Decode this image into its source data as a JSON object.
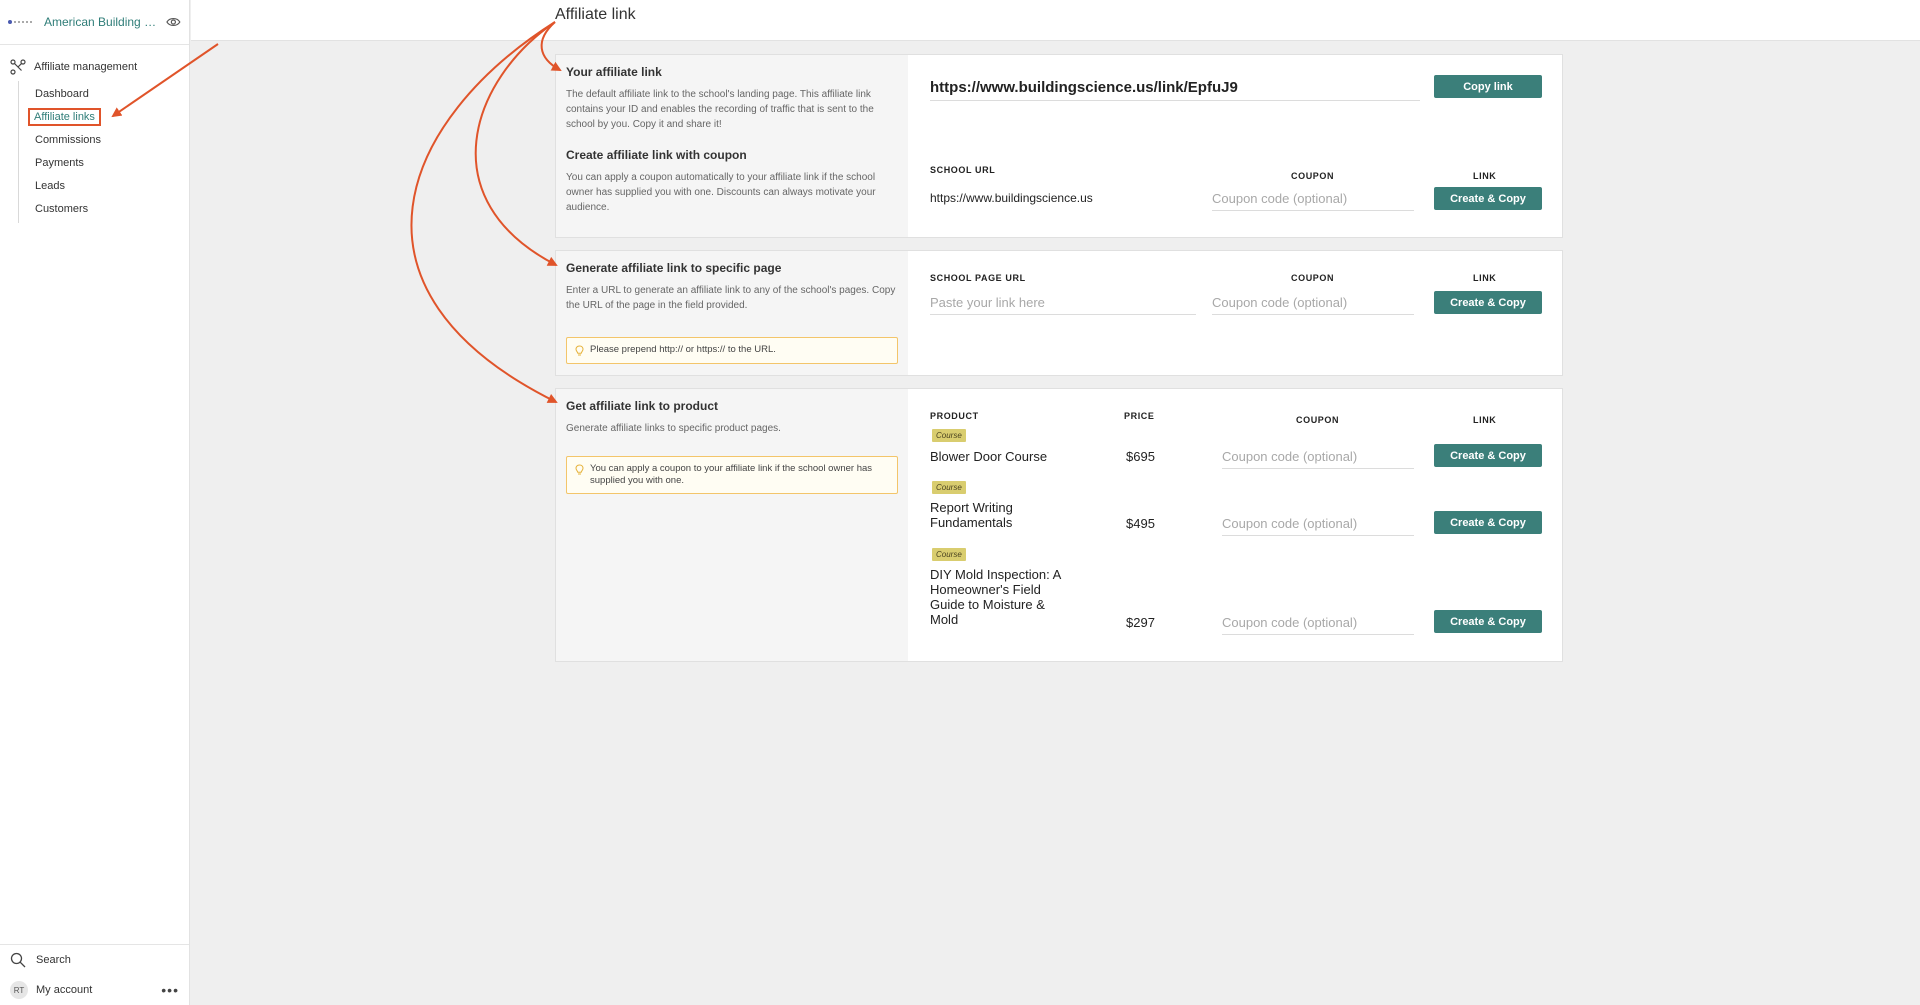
{
  "sidebar": {
    "school_name": "American Building Sc...",
    "section_title": "Affiliate management",
    "items": [
      {
        "label": "Dashboard"
      },
      {
        "label": "Affiliate links"
      },
      {
        "label": "Commissions"
      },
      {
        "label": "Payments"
      },
      {
        "label": "Leads"
      },
      {
        "label": "Customers"
      }
    ],
    "search_label": "Search",
    "account_label": "My account",
    "avatar_initials": "RT"
  },
  "page_title": "Affiliate link",
  "section1": {
    "title": "Your affiliate link",
    "desc": "The default affiliate link to the school's landing page. This affiliate link contains your ID and enables the recording of traffic that is sent to the school by you. Copy it and share it!",
    "link": "https://www.buildingscience.us/link/EpfuJ9",
    "copy_button": "Copy link",
    "coupon_title": "Create affiliate link with coupon",
    "coupon_desc": "You can apply a coupon automatically to your affiliate link if the school owner has supplied you with one. Discounts can always motivate your audience.",
    "col_school_url": "SCHOOL URL",
    "col_coupon": "COUPON",
    "col_link": "LINK",
    "school_url": "https://www.buildingscience.us",
    "coupon_placeholder": "Coupon code (optional)",
    "create_button": "Create & Copy"
  },
  "section2": {
    "title": "Generate affiliate link to specific page",
    "desc": "Enter a URL to generate an affiliate link to any of the school's pages. Copy the URL of the page in the field provided.",
    "tip": "Please prepend http:// or https:// to the URL.",
    "col_page_url": "SCHOOL PAGE URL",
    "col_coupon": "COUPON",
    "col_link": "LINK",
    "page_placeholder": "Paste your link here",
    "coupon_placeholder": "Coupon code (optional)",
    "create_button": "Create & Copy"
  },
  "section3": {
    "title": "Get affiliate link to product",
    "desc": "Generate affiliate links to specific product pages.",
    "tip": "You can apply a coupon to your affiliate link if the school owner has supplied you with one.",
    "col_product": "PRODUCT",
    "col_price": "PRICE",
    "col_coupon": "COUPON",
    "col_link": "LINK",
    "products": [
      {
        "badge": "Course",
        "name": "Blower Door Course",
        "price": "$695"
      },
      {
        "badge": "Course",
        "name": "Report Writing Fundamentals",
        "price": "$495"
      },
      {
        "badge": "Course",
        "name": "DIY Mold Inspection: A Homeowner's Field Guide to Moisture & Mold",
        "price": "$297"
      }
    ],
    "coupon_placeholder": "Coupon code (optional)",
    "create_button": "Create & Copy"
  },
  "colors": {
    "accent": "#3b7f7a",
    "annotation": "#e0542a",
    "badge": "#d9cd6f"
  }
}
